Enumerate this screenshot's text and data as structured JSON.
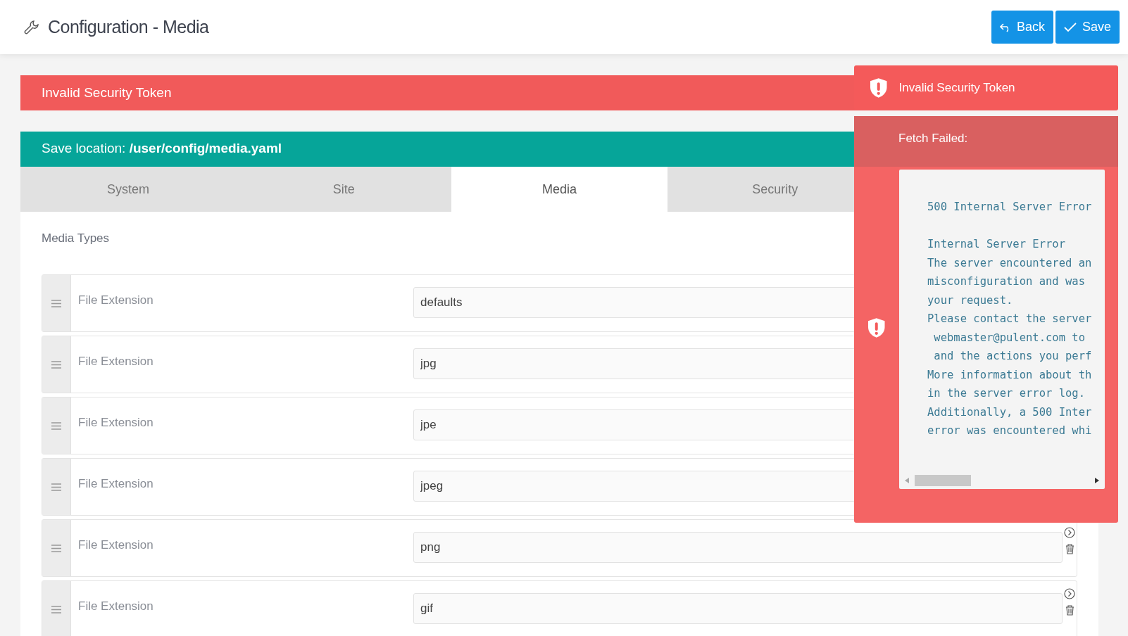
{
  "header": {
    "title": "Configuration - Media",
    "buttons": [
      {
        "label": "Back",
        "kind": "back"
      },
      {
        "label": "Save",
        "kind": "save"
      }
    ]
  },
  "alert": {
    "text": "Invalid Security Token"
  },
  "save_location": {
    "label": "Save location: ",
    "path": "/user/config/media.yaml"
  },
  "tabs": [
    {
      "label": "System",
      "selected": false
    },
    {
      "label": "Site",
      "selected": false
    },
    {
      "label": "Media",
      "selected": true
    },
    {
      "label": "Security",
      "selected": false
    }
  ],
  "section_title": "Media Types",
  "rows": [
    {
      "label": "File Extension",
      "value": "defaults"
    },
    {
      "label": "File Extension",
      "value": "jpg"
    },
    {
      "label": "File Extension",
      "value": "jpe"
    },
    {
      "label": "File Extension",
      "value": "jpeg"
    },
    {
      "label": "File Extension",
      "value": "png"
    },
    {
      "label": "File Extension",
      "value": "gif"
    }
  ],
  "toasts": [
    {
      "title": "Invalid Security Token"
    },
    {
      "title": "Fetch Failed:",
      "details": [
        [
          "500 Internal Server Error"
        ],
        [
          "Internal Server Error",
          "The server encountered an",
          "misconfiguration and was",
          "your request.",
          "Please contact the server",
          " webmaster@pulent.com to",
          " and the actions you perf",
          "More information about th",
          "in the server error log.",
          "Additionally, a 500 Inter",
          "error was encountered whi"
        ]
      ]
    }
  ]
}
